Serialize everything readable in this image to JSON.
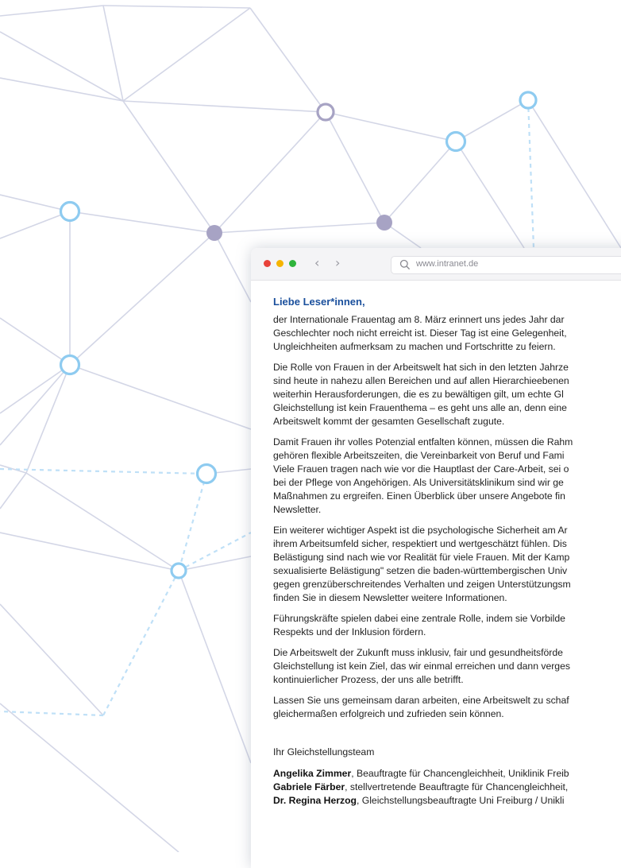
{
  "browser": {
    "url": "www.intranet.de",
    "nav": {
      "back": "‹",
      "forward": "›"
    }
  },
  "letter": {
    "greeting": "Liebe Leser*innen,",
    "paragraphs": [
      [
        "der Internationale Frauentag am 8. März erinnert uns jedes Jahr dar",
        "Geschlechter noch nicht erreicht ist. Dieser Tag ist eine Gelegenheit,",
        "Ungleichheiten aufmerksam zu machen und Fortschritte zu feiern."
      ],
      [
        "Die Rolle von Frauen in der Arbeitswelt hat sich in den letzten Jahrze",
        "sind heute in nahezu allen Bereichen und auf allen Hierarchieebenen",
        "weiterhin Herausforderungen, die es zu bewältigen gilt, um echte Gl",
        "Gleichstellung ist kein Frauenthema – es geht uns alle an, denn eine",
        "Arbeitswelt kommt der gesamten Gesellschaft zugute."
      ],
      [
        "Damit Frauen ihr volles Potenzial entfalten können, müssen die Rahm",
        "gehören flexible Arbeitszeiten, die Vereinbarkeit von Beruf und Fami",
        "Viele Frauen tragen nach wie vor die Hauptlast der Care-Arbeit, sei o",
        "bei der Pflege von Angehörigen. Als Universitätsklinikum sind wir ge",
        "Maßnahmen zu ergreifen. Einen Überblick über unsere Angebote fin",
        "Newsletter."
      ],
      [
        "Ein weiterer wichtiger Aspekt ist die psychologische Sicherheit am Ar",
        "ihrem Arbeitsumfeld sicher, respektiert und wertgeschätzt fühlen. Dis",
        "Belästigung sind nach wie vor Realität für viele Frauen. Mit der Kamp",
        "sexualisierte Belästigung\" setzen die baden-württembergischen Univ",
        "gegen grenzüberschreitendes Verhalten und zeigen Unterstützungsm",
        "finden Sie in diesem Newsletter weitere Informationen."
      ],
      [
        "Führungskräfte spielen dabei eine zentrale Rolle, indem sie Vorbilde",
        "Respekts und der Inklusion fördern."
      ],
      [
        "Die Arbeitswelt der Zukunft muss inklusiv, fair und gesundheitsförde",
        "Gleichstellung ist kein Ziel, das wir einmal erreichen und dann verges",
        "kontinuierlicher Prozess, der uns alle betrifft."
      ],
      [
        "Lassen Sie uns gemeinsam daran arbeiten, eine Arbeitswelt zu schaf",
        "gleichermaßen erfolgreich und zufrieden sein können."
      ]
    ],
    "signoff": "Ihr Gleichstellungsteam",
    "signatories": [
      {
        "name": "Angelika Zimmer",
        "role": ", Beauftragte für Chancengleichheit, Uniklinik Freib"
      },
      {
        "name": "Gabriele Färber",
        "role": ", stellvertretende Beauftragte für Chancengleichheit,"
      },
      {
        "name": "Dr. Regina Herzog",
        "role": ", Gleichstellungsbeauftragte Uni Freiburg / Unikli"
      }
    ]
  },
  "colors": {
    "line": "#cfd2e2",
    "line_blue": "#b5dcf6",
    "node_blue": "#8ecbf0",
    "node_grey": "#a7a3c4",
    "greeting": "#1a4f9c"
  }
}
